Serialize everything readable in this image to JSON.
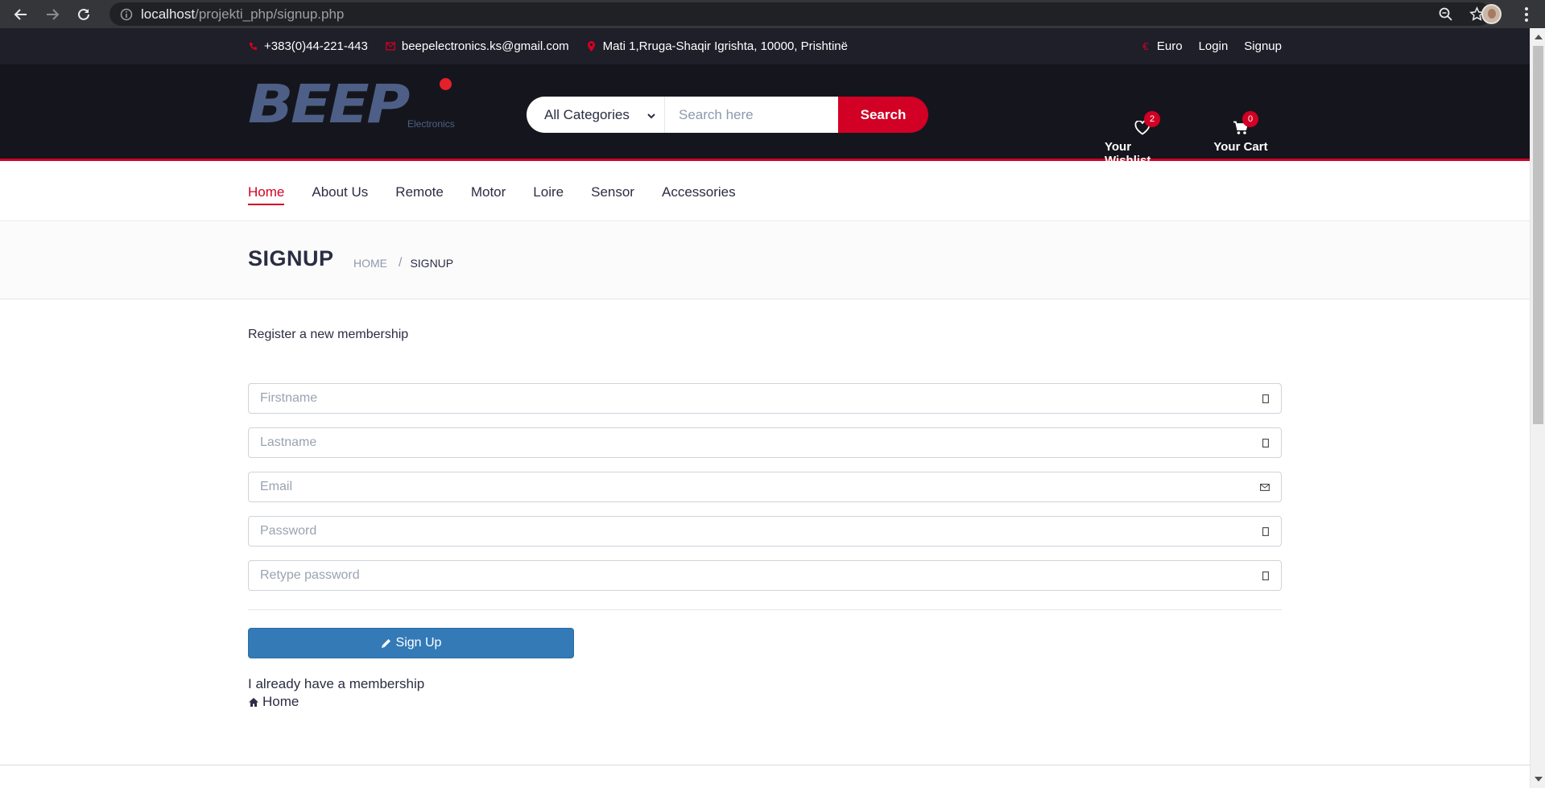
{
  "browser": {
    "url_host": "localhost",
    "url_path": "/projekti_php/signup.php"
  },
  "top_header": {
    "phone": "+383(0)44-221-443",
    "email": "beepelectronics.ks@gmail.com",
    "address": "Mati 1,Rruga-Shaqir Igrishta, 10000, Prishtinë",
    "currency": "Euro",
    "currency_symbol": "€",
    "login": "Login",
    "signup": "Signup"
  },
  "logo": {
    "text": "BEEP",
    "sub": "Electronics"
  },
  "search": {
    "category": "All Categories",
    "placeholder": "Search here",
    "button": "Search"
  },
  "wishlist": {
    "label": "Your Wishlist",
    "count": "2"
  },
  "cart": {
    "label": "Your Cart",
    "count": "0"
  },
  "nav": {
    "items": [
      "Home",
      "About Us",
      "Remote",
      "Motor",
      "Loire",
      "Sensor",
      "Accessories"
    ],
    "active": "Home"
  },
  "breadcrumb": {
    "title": "SIGNUP",
    "home": "HOME",
    "separator": "/",
    "current": "SIGNUP"
  },
  "form": {
    "message": "Register a new membership",
    "firstname_placeholder": "Firstname",
    "lastname_placeholder": "Lastname",
    "email_placeholder": "Email",
    "password_placeholder": "Password",
    "retype_placeholder": "Retype password",
    "submit": "Sign Up",
    "already": "I already have a membership",
    "home_link": "Home"
  },
  "colors": {
    "accent": "#d10024",
    "header_dark": "#15161d",
    "topbar": "#1e1f29",
    "button_blue": "#337ab7"
  }
}
